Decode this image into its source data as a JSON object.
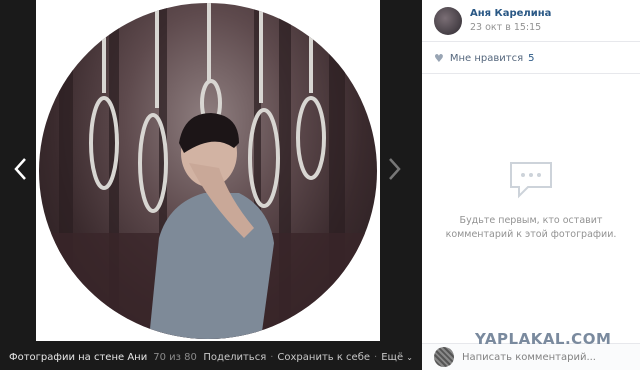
{
  "viewer": {
    "prev_icon": "chevron-left-icon",
    "next_icon": "chevron-right-icon"
  },
  "footer": {
    "album_label": "Фотографии на стене Ани",
    "counter": "70 из 80",
    "share_label": "Поделиться",
    "save_label": "Сохранить к себе",
    "more_label": "Ещё"
  },
  "author": {
    "name": "Аня Карелина",
    "time": "23 окт в 15:15"
  },
  "likes": {
    "label": "Мне нравится",
    "count": "5"
  },
  "comments": {
    "empty_text": "Будьте первым, кто оставит комментарий к этой фотографии.",
    "input_placeholder": "Написать комментарий..."
  },
  "watermark": "YAPLAKAL.COM",
  "colors": {
    "link": "#2a5885",
    "viewer_bg": "#1a1a1a",
    "panel_bg": "#ffffff"
  }
}
